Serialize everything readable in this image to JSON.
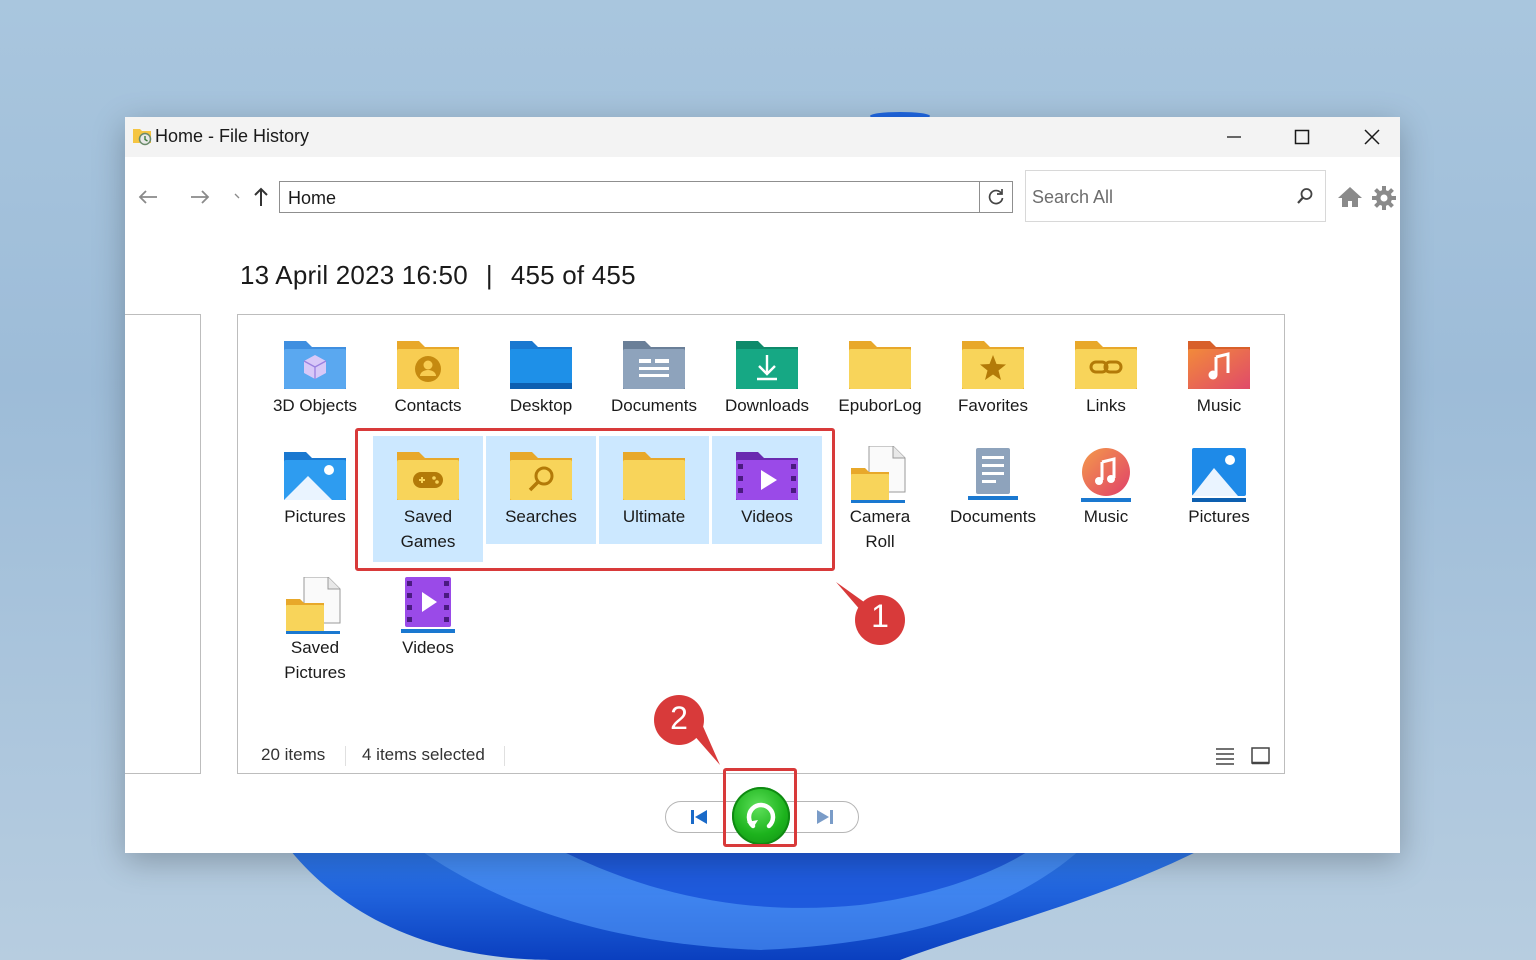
{
  "window": {
    "title": "Home - File History"
  },
  "toolbar": {
    "address": "Home",
    "search_placeholder": "Search All"
  },
  "info": {
    "datetime": "13 April 2023 16:50",
    "separator": "|",
    "count": "455 of 455"
  },
  "items": [
    {
      "label": "3D Objects",
      "icon": "3d-objects-folder-icon",
      "selected": false
    },
    {
      "label": "Contacts",
      "icon": "contacts-folder-icon",
      "selected": false
    },
    {
      "label": "Desktop",
      "icon": "desktop-folder-icon",
      "selected": false
    },
    {
      "label": "Documents",
      "icon": "documents-folder-icon",
      "selected": false
    },
    {
      "label": "Downloads",
      "icon": "downloads-folder-icon",
      "selected": false
    },
    {
      "label": "EpuborLog",
      "icon": "folder-icon",
      "selected": false
    },
    {
      "label": "Favorites",
      "icon": "favorites-folder-icon",
      "selected": false
    },
    {
      "label": "Links",
      "icon": "links-folder-icon",
      "selected": false
    },
    {
      "label": "Music",
      "icon": "music-folder-icon",
      "selected": false
    },
    {
      "label": "Pictures",
      "icon": "pictures-folder-icon",
      "selected": false
    },
    {
      "label": "Saved\nGames",
      "icon": "saved-games-folder-icon",
      "selected": true
    },
    {
      "label": "Searches",
      "icon": "searches-folder-icon",
      "selected": true
    },
    {
      "label": "Ultimate",
      "icon": "folder-icon",
      "selected": true
    },
    {
      "label": "Videos",
      "icon": "videos-folder-icon",
      "selected": true
    },
    {
      "label": "Camera\nRoll",
      "icon": "camera-roll-folder-icon",
      "selected": false
    },
    {
      "label": "Documents",
      "icon": "documents-library-icon",
      "selected": false
    },
    {
      "label": "Music",
      "icon": "music-library-icon",
      "selected": false
    },
    {
      "label": "Pictures",
      "icon": "pictures-library-icon",
      "selected": false
    },
    {
      "label": "Saved\nPictures",
      "icon": "saved-pictures-folder-icon",
      "selected": false
    },
    {
      "label": "Videos",
      "icon": "videos-library-icon",
      "selected": false
    }
  ],
  "status": {
    "items": "20 items",
    "selected": "4 items selected"
  },
  "annotations": {
    "step1": "1",
    "step2": "2"
  },
  "colors": {
    "selection": "#cce8ff",
    "highlight_box": "#d83a3a",
    "restore": "#1db31d",
    "folder": "#f5c542"
  }
}
